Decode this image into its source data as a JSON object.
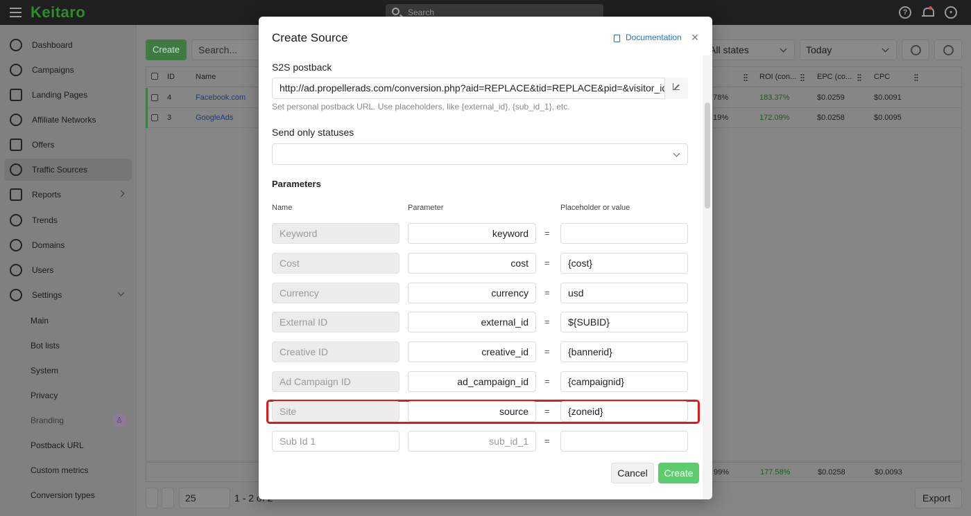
{
  "topbar": {
    "logo": "Keitaro",
    "search_placeholder": "Search"
  },
  "sidebar": {
    "items": [
      {
        "label": "Dashboard"
      },
      {
        "label": "Campaigns"
      },
      {
        "label": "Landing Pages"
      },
      {
        "label": "Affiliate Networks"
      },
      {
        "label": "Offers"
      },
      {
        "label": "Traffic Sources"
      },
      {
        "label": "Reports"
      },
      {
        "label": "Trends"
      },
      {
        "label": "Domains"
      },
      {
        "label": "Users"
      },
      {
        "label": "Settings"
      }
    ],
    "settings_sub": [
      "Main",
      "Bot lists",
      "System",
      "Privacy",
      "Branding",
      "Postback URL",
      "Custom metrics",
      "Conversion types"
    ]
  },
  "toolbar": {
    "create_label": "Create",
    "search_placeholder": "Search...",
    "state_filter": "All states",
    "date_filter": "Today"
  },
  "table": {
    "headers": {
      "id": "ID",
      "name": "Name",
      "roi": "ROI (con...",
      "epc": "EPC (co...",
      "cpc": "CPC"
    },
    "rows": [
      {
        "id": "4",
        "name": "Facebook.com",
        "cr": "78%",
        "roi": "183.37%",
        "epc": "$0.0259",
        "cpc": "$0.0091"
      },
      {
        "id": "3",
        "name": "GoogleAds",
        "cr": "19%",
        "roi": "172.09%",
        "epc": "$0.0258",
        "cpc": "$0.0095"
      }
    ],
    "totals": {
      "cr": "99%",
      "roi": "177.58%",
      "epc": "$0.0258",
      "cpc": "$0.0093"
    }
  },
  "pagination": {
    "per_page": "25",
    "range": "1 - 2 of 2"
  },
  "export_label": "Export",
  "modal": {
    "title": "Create Source",
    "documentation": "Documentation",
    "postback_label": "S2S postback",
    "postback_value": "http://ad.propellerads.com/conversion.php?aid=REPLACE&tid=REPLACE&pid=&visitor_id={ext",
    "postback_hint": "Set personal postback URL. Use placeholders, like {external_id}, {sub_id_1}, etc.",
    "statuses_label": "Send only statuses",
    "parameters_label": "Parameters",
    "col_name": "Name",
    "col_parameter": "Parameter",
    "col_value": "Placeholder or value",
    "params": [
      {
        "name": "Keyword",
        "param": "keyword",
        "value": ""
      },
      {
        "name": "Cost",
        "param": "cost",
        "value": "{cost}"
      },
      {
        "name": "Currency",
        "param": "currency",
        "value": "usd"
      },
      {
        "name": "External ID",
        "param": "external_id",
        "value": "${SUBID}"
      },
      {
        "name": "Creative ID",
        "param": "creative_id",
        "value": "{bannerid}"
      },
      {
        "name": "Ad Campaign ID",
        "param": "ad_campaign_id",
        "value": "{campaignid}"
      },
      {
        "name": "Site",
        "param": "source",
        "value": "{zoneid}"
      },
      {
        "name": "Sub Id 1",
        "param": "sub_id_1",
        "value": ""
      }
    ],
    "eq": "=",
    "cancel_label": "Cancel",
    "create_label": "Create"
  }
}
